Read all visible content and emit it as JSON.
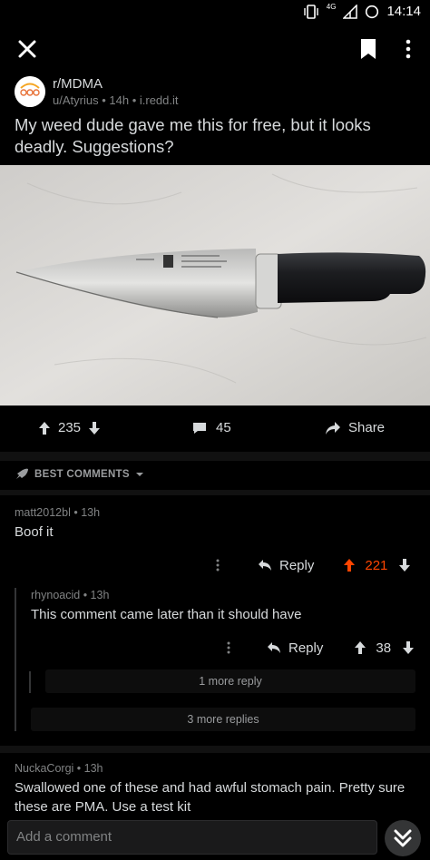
{
  "status_bar": {
    "network": "4G",
    "time": "14:14"
  },
  "post": {
    "subreddit": "r/MDMA",
    "author": "u/Atyrius",
    "age": "14h",
    "domain": "i.redd.it",
    "title": "My weed dude gave me this for free, but it looks deadly. Suggestions?",
    "score": "235",
    "comment_count": "45",
    "share_label": "Share"
  },
  "sort": {
    "label": "BEST COMMENTS"
  },
  "comments": [
    {
      "author": "matt2012bl",
      "age": "13h",
      "body": "Boof it",
      "reply_label": "Reply",
      "score": "221"
    },
    {
      "author": "rhynoacid",
      "age": "13h",
      "body": "This comment came later than it should have",
      "reply_label": "Reply",
      "score": "38"
    },
    {
      "author": "NuckaCorgi",
      "age": "13h",
      "body": "Swallowed one of these and had awful stomach pain. Pretty sure these are PMA. Use a test kit"
    }
  ],
  "more": {
    "nested": "1 more reply",
    "top": "3 more replies"
  },
  "composer": {
    "placeholder": "Add a comment"
  },
  "colors": {
    "upvote_active": "#ff4500",
    "background": "#000000",
    "text": "#d7dadc",
    "muted": "#818384"
  },
  "icons": [
    "close-icon",
    "bookmark-icon",
    "more-vert-icon",
    "upvote-icon",
    "downvote-icon",
    "comment-icon",
    "share-icon",
    "rocket-icon",
    "chevron-down-icon",
    "reply-icon",
    "double-chevron-down-icon"
  ]
}
